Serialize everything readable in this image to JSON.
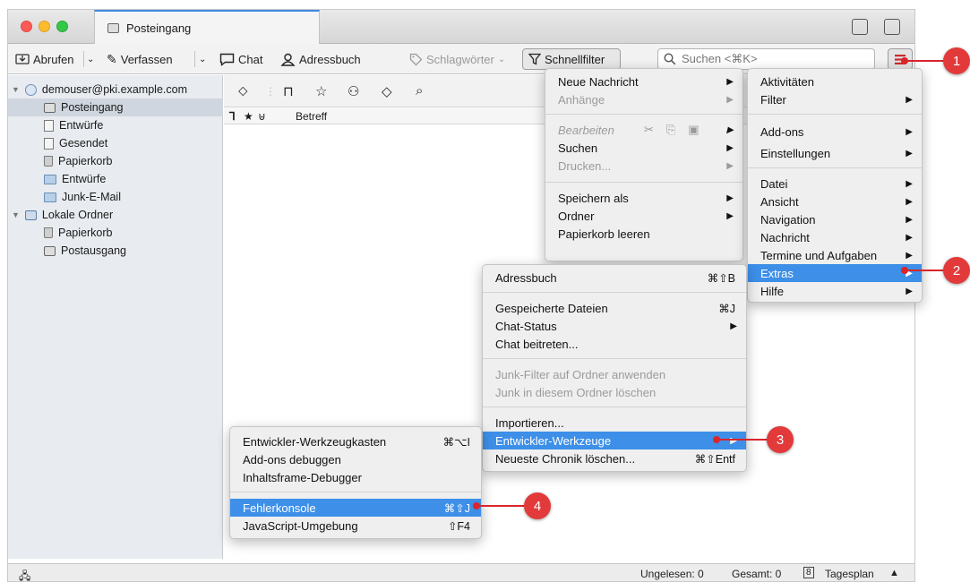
{
  "window": {
    "tab_title": "Posteingang",
    "colors": {
      "accent": "#3d8fe8",
      "callout": "#e23a3a",
      "sidebar_bg": "#e8ecf0"
    }
  },
  "toolbar": {
    "get_label": "Abrufen",
    "write_label": "Verfassen",
    "chat_label": "Chat",
    "addressbook_label": "Adressbuch",
    "tags_label": "Schlagwörter",
    "quickfilter_label": "Schnellfilter",
    "search_placeholder": "Suchen <⌘K>"
  },
  "sidebar": {
    "account": "demouser@pki.example.com",
    "account_items": [
      "Posteingang",
      "Entwürfe",
      "Gesendet",
      "Papierkorb",
      "Entwürfe",
      "Junk-E-Mail"
    ],
    "local_folders": "Lokale Ordner",
    "local_items": [
      "Papierkorb",
      "Postausgang"
    ]
  },
  "messages": {
    "col_subject": "Betreff"
  },
  "statusbar": {
    "unread": "Ungelesen: 0",
    "total": "Gesamt: 0",
    "dayplan": "Tagesplan"
  },
  "menu_left": {
    "new_message": "Neue Nachricht",
    "attachments": "Anhänge",
    "edit": "Bearbeiten",
    "search": "Suchen",
    "print": "Drucken...",
    "save_as": "Speichern als",
    "folder": "Ordner",
    "empty_trash": "Papierkorb leeren"
  },
  "menu_right": {
    "activities": "Aktivitäten",
    "filter": "Filter",
    "addons": "Add-ons",
    "settings": "Einstellungen",
    "file": "Datei",
    "view": "Ansicht",
    "navigation": "Navigation",
    "message": "Nachricht",
    "tasks": "Termine und Aufgaben",
    "extras": "Extras",
    "help": "Hilfe"
  },
  "menu_extras": {
    "addressbook": "Adressbuch",
    "addressbook_sc": "⌘⇧B",
    "saved_files": "Gespeicherte Dateien",
    "saved_files_sc": "⌘J",
    "chat_status": "Chat-Status",
    "join_chat": "Chat beitreten...",
    "junk_apply": "Junk-Filter auf Ordner anwenden",
    "junk_delete": "Junk in diesem Ordner löschen",
    "import": "Importieren...",
    "devtools": "Entwickler-Werkzeuge",
    "clear_history": "Neueste Chronik löschen...",
    "clear_history_sc": "⌘⇧Entf"
  },
  "menu_devtools": {
    "toolbox": "Entwickler-Werkzeugkasten",
    "toolbox_sc": "⌘⌥I",
    "addon_debug": "Add-ons debuggen",
    "frame_debug": "Inhaltsframe-Debugger",
    "error_console": "Fehlerkonsole",
    "error_console_sc": "⌘⇧J",
    "js_env": "JavaScript-Umgebung",
    "js_env_sc": "⇧F4"
  },
  "callouts": [
    "1",
    "2",
    "3",
    "4"
  ]
}
